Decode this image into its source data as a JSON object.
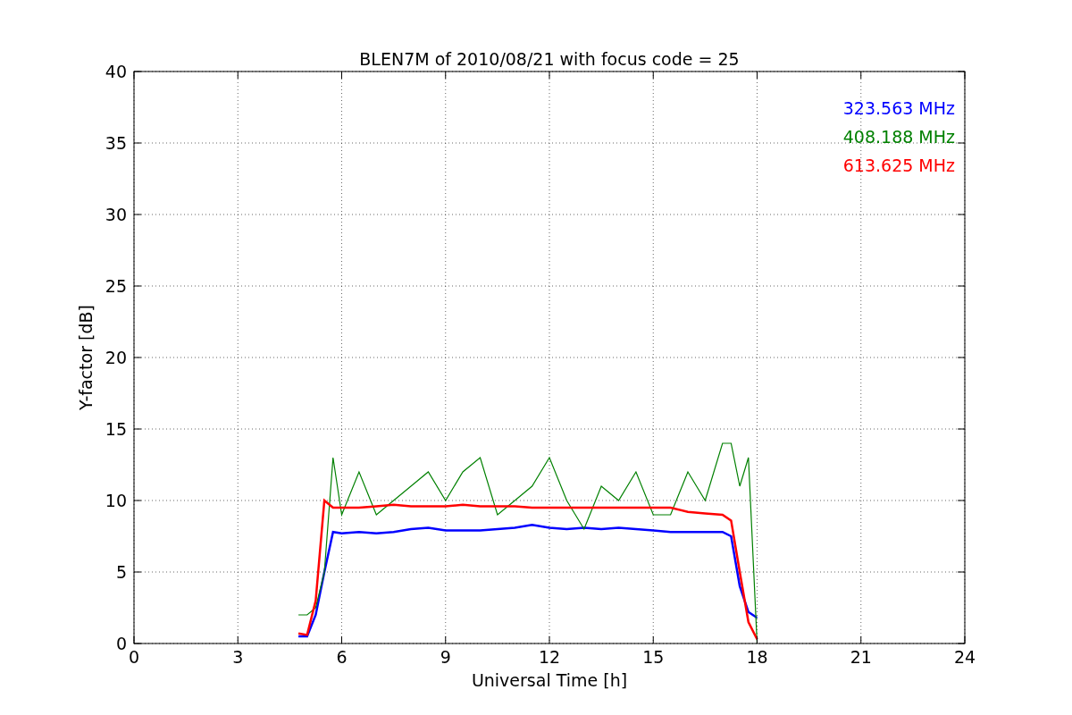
{
  "chart_data": {
    "type": "line",
    "title": "BLEN7M of 2010/08/21 with focus code = 25",
    "xlabel": "Universal Time [h]",
    "ylabel": "Y-factor [dB]",
    "x": [
      4.75,
      5.0,
      5.25,
      5.5,
      5.75,
      6,
      6.5,
      7,
      7.5,
      8,
      8.5,
      9,
      9.5,
      10,
      10.5,
      11,
      11.5,
      12,
      12.5,
      13,
      13.5,
      14,
      14.5,
      15,
      15.5,
      16,
      16.5,
      17,
      17.25,
      17.5,
      17.75,
      18
    ],
    "series": [
      {
        "name": "323.563 MHz",
        "color": "#0000ff",
        "values": [
          0.5,
          0.5,
          2,
          5,
          7.8,
          7.7,
          7.8,
          7.7,
          7.8,
          8,
          8.1,
          7.9,
          7.9,
          7.9,
          8,
          8.1,
          8.3,
          8.1,
          8,
          8.1,
          8,
          8.1,
          8,
          7.9,
          7.8,
          7.8,
          7.8,
          7.8,
          7.5,
          4,
          2.2,
          1.8
        ]
      },
      {
        "name": "408.188 MHz",
        "color": "#008000",
        "values": [
          2,
          2,
          2.5,
          5,
          13,
          9,
          12,
          9,
          10,
          11,
          12,
          10,
          12,
          13,
          9,
          10,
          11,
          13,
          10,
          8,
          11,
          10,
          12,
          9,
          9,
          12,
          10,
          14,
          14,
          11,
          13,
          0
        ]
      },
      {
        "name": "613.625 MHz",
        "color": "#ff0000",
        "values": [
          0.7,
          0.6,
          3,
          10,
          9.5,
          9.5,
          9.5,
          9.6,
          9.7,
          9.6,
          9.6,
          9.6,
          9.7,
          9.6,
          9.6,
          9.6,
          9.5,
          9.5,
          9.5,
          9.5,
          9.5,
          9.5,
          9.5,
          9.5,
          9.5,
          9.2,
          9.1,
          9,
          8.6,
          5,
          1.5,
          0.3
        ]
      }
    ],
    "xlim": [
      0,
      24
    ],
    "ylim": [
      0,
      40
    ],
    "xticks": [
      0,
      3,
      6,
      9,
      12,
      15,
      18,
      21,
      24
    ],
    "yticks": [
      0,
      5,
      10,
      15,
      20,
      25,
      30,
      35,
      40
    ],
    "grid": true
  }
}
